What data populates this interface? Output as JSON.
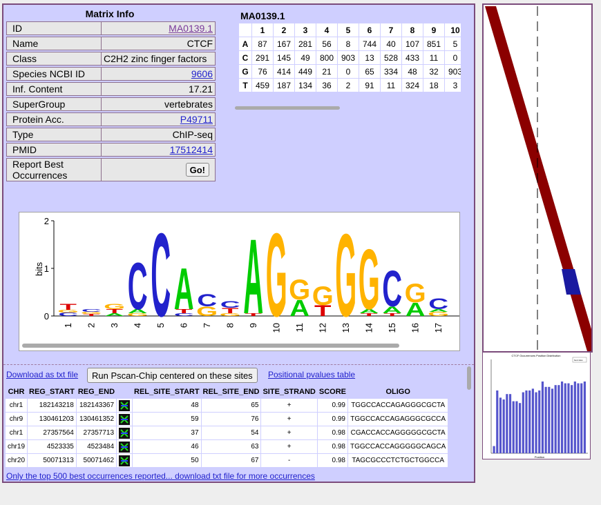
{
  "matrix_info": {
    "title": "Matrix Info",
    "rows": [
      {
        "label": "ID",
        "value": "MA0139.1",
        "link": true
      },
      {
        "label": "Name",
        "value": "CTCF"
      },
      {
        "label": "Class",
        "value": "C2H2 zinc finger factors"
      },
      {
        "label": "Species NCBI ID",
        "value": "9606",
        "link": true
      },
      {
        "label": "Inf. Content",
        "value": "17.21"
      },
      {
        "label": "SuperGroup",
        "value": "vertebrates"
      },
      {
        "label": "Protein Acc.",
        "value": "P49711",
        "link": true
      },
      {
        "label": "Type",
        "value": "ChIP-seq"
      },
      {
        "label": "PMID",
        "value": "17512414",
        "link": true
      }
    ],
    "report_label": "Report Best Occurrences",
    "go_label": "Go!"
  },
  "pfm": {
    "title": "MA0139.1",
    "columns": [
      "1",
      "2",
      "3",
      "4",
      "5",
      "6",
      "7",
      "8",
      "9",
      "10"
    ],
    "rows": [
      {
        "base": "A",
        "values": [
          "87",
          "167",
          "281",
          "56",
          "8",
          "744",
          "40",
          "107",
          "851",
          "5"
        ]
      },
      {
        "base": "C",
        "values": [
          "291",
          "145",
          "49",
          "800",
          "903",
          "13",
          "528",
          "433",
          "11",
          "0"
        ]
      },
      {
        "base": "G",
        "values": [
          "76",
          "414",
          "449",
          "21",
          "0",
          "65",
          "334",
          "48",
          "32",
          "903"
        ]
      },
      {
        "base": "T",
        "values": [
          "459",
          "187",
          "134",
          "36",
          "2",
          "91",
          "11",
          "324",
          "18",
          "3"
        ]
      }
    ]
  },
  "logo": {
    "y_label": "bits",
    "y_ticks": [
      "2",
      "1",
      "0"
    ],
    "positions": [
      "1",
      "2",
      "3",
      "4",
      "5",
      "6",
      "7",
      "8",
      "9",
      "10",
      "11",
      "12",
      "13",
      "14",
      "15",
      "16",
      "17"
    ],
    "colors": {
      "A": "#00cc00",
      "C": "#2222cc",
      "G": "#ffb300",
      "T": "#dd0000"
    }
  },
  "occurrences": {
    "download_txt": "Download as txt file",
    "pscan_button": "Run Pscan-Chip centered on these sites",
    "pvalues_link": "Positional pvalues table",
    "headers": [
      "CHR",
      "REG_START",
      "REG_END",
      "",
      "REL_SITE_START",
      "REL_SITE_END",
      "SITE_STRAND",
      "SCORE",
      "OLIGO"
    ],
    "rows": [
      [
        "chr1",
        "182143218",
        "182143367",
        "",
        "48",
        "65",
        "+",
        "0.99",
        "TGGCCACCAGAGGGCGCTA"
      ],
      [
        "chr9",
        "130461203",
        "130461352",
        "",
        "59",
        "76",
        "+",
        "0.99",
        "TGGCCACCAGAGGGCGCCA"
      ],
      [
        "chr1",
        "27357564",
        "27357713",
        "",
        "37",
        "54",
        "+",
        "0.98",
        "CGACCACCAGGGGGCGCTA"
      ],
      [
        "chr19",
        "4523335",
        "4523484",
        "",
        "46",
        "63",
        "+",
        "0.98",
        "TGGCCACCAGGGGGCAGCA"
      ],
      [
        "chr20",
        "50071313",
        "50071462",
        "",
        "50",
        "67",
        "-",
        "0.98",
        "TAGCGCCCTCTGCTGGCCA"
      ]
    ],
    "footer_link": "Only the top 500 best occurrences reported... download txt file for more occurrences"
  },
  "distribution": {
    "title": "CTCF Occurrences Position Distribution",
    "x_label": "Position",
    "legend": "best sites",
    "bar_heights": [
      0.08,
      0.7,
      0.62,
      0.6,
      0.66,
      0.66,
      0.58,
      0.58,
      0.56,
      0.68,
      0.7,
      0.7,
      0.72,
      0.68,
      0.7,
      0.8,
      0.74,
      0.74,
      0.72,
      0.76,
      0.76,
      0.8,
      0.78,
      0.78,
      0.76,
      0.8,
      0.78,
      0.78,
      0.8
    ],
    "colors": {
      "bar": "#5555cc"
    }
  },
  "heatmap": {
    "colors": {
      "band": "#8b0000",
      "highlight": "#1a1aa0"
    }
  }
}
